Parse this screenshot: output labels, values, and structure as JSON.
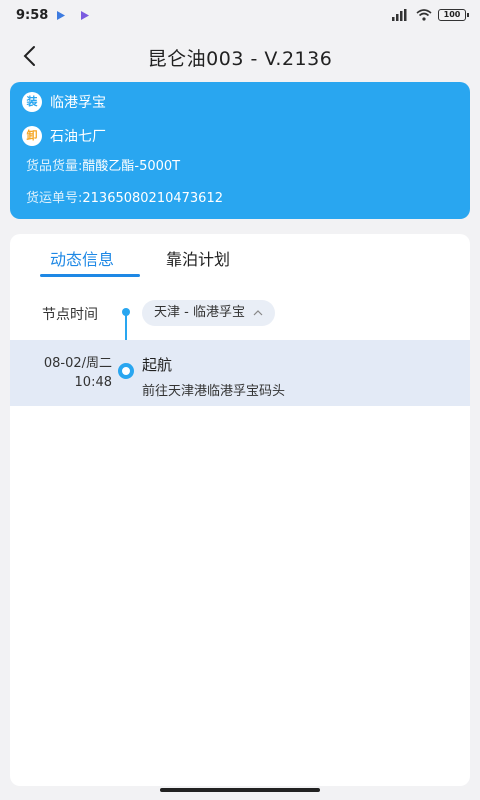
{
  "status_bar": {
    "time": "9:58",
    "battery": "100"
  },
  "header": {
    "title": "昆仑油003 - V.2136"
  },
  "info_card": {
    "load_badge": "装",
    "load_port": "临港孚宝",
    "unload_badge": "卸",
    "unload_port": "石油七厂",
    "cargo_label": "货品货量:",
    "cargo_value": "醋酸乙酯-5000T",
    "waybill_label": "货运单号:",
    "waybill_value": "21365080210473612",
    "color": "#29a6f0"
  },
  "tabs": [
    {
      "label": "动态信息",
      "active": true
    },
    {
      "label": "靠泊计划",
      "active": false
    }
  ],
  "timeline": {
    "column_label": "节点时间",
    "route": "天津 - 临港孚宝",
    "events": [
      {
        "date": "08-02/周二",
        "time": "10:48",
        "title": "起航",
        "description": "前往天津港临港孚宝码头"
      }
    ]
  },
  "colors": {
    "accent": "#1e88e5",
    "highlight_row": "#e3eaf6"
  }
}
